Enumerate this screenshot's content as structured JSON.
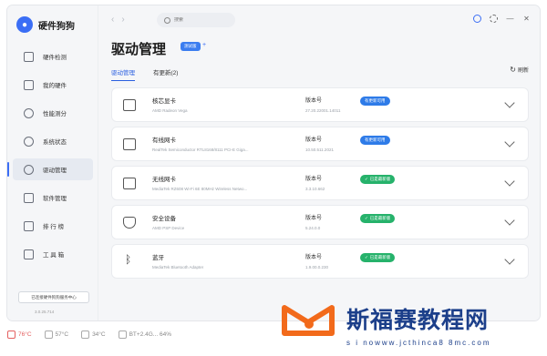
{
  "app": {
    "title": "硬件狗狗",
    "version": "3.0.25.714"
  },
  "sidebar": {
    "items": [
      {
        "label": "硬件检测",
        "icon": "monitor-icon"
      },
      {
        "label": "我的硬件",
        "icon": "device-icon"
      },
      {
        "label": "性能测分",
        "icon": "speed-icon"
      },
      {
        "label": "系统状态",
        "icon": "status-icon"
      },
      {
        "label": "驱动管理",
        "icon": "driver-icon",
        "active": true
      },
      {
        "label": "软件管理",
        "icon": "apps-icon"
      },
      {
        "label": "排 行 榜",
        "icon": "ranking-icon"
      },
      {
        "label": "工 具 箱",
        "icon": "toolbox-icon"
      }
    ],
    "footer_button": "已连接硬件狗狗服务中心"
  },
  "toolbar": {
    "search_placeholder": "搜索"
  },
  "page": {
    "title": "驱动管理",
    "badge": "测试版",
    "plus": "+",
    "tabs": [
      {
        "label": "驱动管理",
        "active": true
      },
      {
        "label": "有更新(2)"
      }
    ],
    "refresh_label": "刷新"
  },
  "drivers": [
    {
      "name": "核芯显卡",
      "desc": "AMD Radeon Vega",
      "version_label": "版本号",
      "version": "27.20.22001.14011",
      "status": "有更新可用",
      "status_type": "update",
      "icon": "gpu-icon"
    },
    {
      "name": "有线网卡",
      "desc": "RealTek Semiconductor RTL8168/8111 PCI-E Giga...",
      "version_label": "版本号",
      "version": "10.50.511.2021",
      "status": "有更新可用",
      "status_type": "update",
      "icon": "ethernet-icon"
    },
    {
      "name": "无线网卡",
      "desc": "MediaTek RZ608 Wi-Fi 6E 80MHz Wireless Netwo...",
      "version_label": "版本号",
      "version": "3.3.10.662",
      "status": "已是最新版",
      "status_type": "ok",
      "icon": "wifi-icon"
    },
    {
      "name": "安全设备",
      "desc": "AMD PSP Device",
      "version_label": "版本号",
      "version": "5.24.0.0",
      "status": "已是最新版",
      "status_type": "ok",
      "icon": "shield-icon"
    },
    {
      "name": "蓝牙",
      "desc": "MediaTek Bluetooth Adapter",
      "version_label": "版本号",
      "version": "1.9.00.0.230",
      "status": "已是最新版",
      "status_type": "ok",
      "icon": "bluetooth-icon"
    }
  ],
  "statusbar": [
    {
      "value": "76°C",
      "hot": true,
      "icon": "cpu-temp-icon"
    },
    {
      "value": "57°C",
      "icon": "gpu-temp-icon"
    },
    {
      "value": "34°C",
      "icon": "disk-temp-icon"
    },
    {
      "value": "BT+2.4G... 64%",
      "icon": "battery-icon"
    }
  ],
  "watermark": {
    "text": "斯福赛教程网",
    "url": "s i nowww.jcthinca8 8mc.com"
  },
  "colors": {
    "accent": "#3b6ef5",
    "update": "#2e7be8",
    "ok": "#26b26b",
    "hot": "#e46060"
  }
}
